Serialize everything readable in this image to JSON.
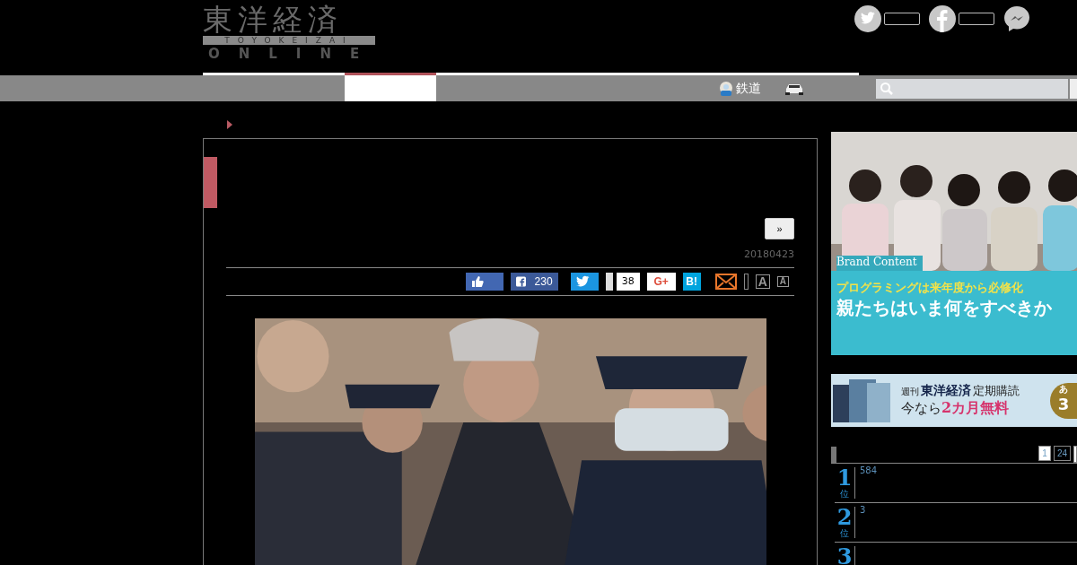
{
  "logo": {
    "title": "東洋経済",
    "romaji": "TOYOKEIZAI",
    "sub": "ONLINE"
  },
  "social": [
    {
      "kind": "twitter"
    },
    {
      "kind": "facebook"
    },
    {
      "kind": "messenger"
    }
  ],
  "nav": {
    "tabs": [
      {
        "selected": true
      }
    ],
    "links": [
      {
        "kind": "train",
        "label": "鉄道"
      },
      {
        "kind": "car"
      }
    ]
  },
  "article": {
    "next_button": "»",
    "date": "20180423",
    "share": [
      {
        "kind": "like"
      },
      {
        "kind": "facebook",
        "count": "230"
      },
      {
        "kind": "twitter"
      },
      {
        "kind": "pocket",
        "count": "38"
      },
      {
        "kind": "gplus",
        "label": "G+"
      },
      {
        "kind": "hatena",
        "label": "B!"
      },
      {
        "kind": "mail"
      },
      {
        "kind": "divider"
      },
      {
        "kind": "font-large",
        "label": "A"
      },
      {
        "kind": "font-small",
        "label": "A"
      }
    ]
  },
  "ad": {
    "badge": "Brand Content",
    "headline": "プログラミングは来年度から必修化",
    "title": "親たちはいま何をすべきか"
  },
  "subscription": {
    "small": "週刊",
    "brand": "東洋経済",
    "label": "定期購読",
    "offer_prefix": "今なら",
    "offer_highlight": "2カ月無料",
    "badge_top": "あ",
    "badge_num": "3"
  },
  "ranking": {
    "tabs": [
      {
        "label": "1",
        "selected": true
      },
      {
        "label": "24",
        "selected": false
      }
    ],
    "rows": [
      {
        "rank": "1",
        "unit": "位",
        "text": "584"
      },
      {
        "rank": "2",
        "unit": "位",
        "text": "3"
      },
      {
        "rank": "3",
        "unit": "",
        "text": ""
      }
    ]
  }
}
